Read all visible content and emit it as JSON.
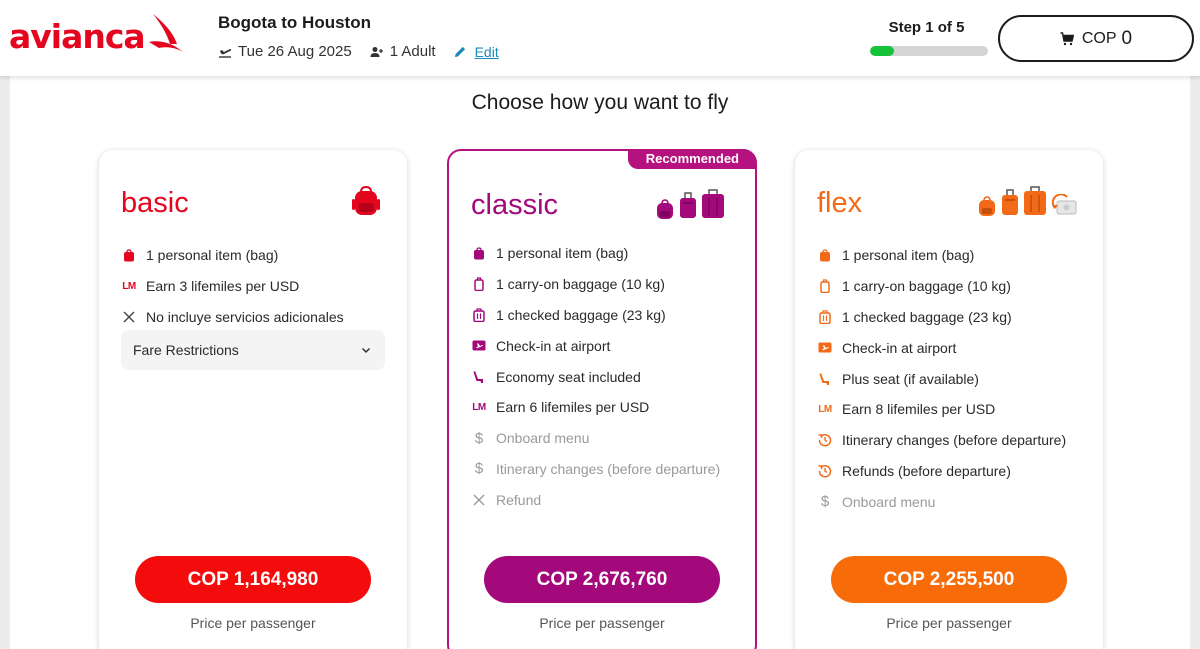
{
  "brand": {
    "name": "avianca",
    "color": "#e4051f"
  },
  "trip": {
    "route": "Bogota to Houston",
    "date": "Tue 26 Aug 2025",
    "passengers": "1 Adult",
    "edit_label": "Edit"
  },
  "progress": {
    "label": "Step 1 of 5",
    "current_step": 1,
    "total_steps": 5,
    "fraction": 0.2,
    "color": "#17c23b"
  },
  "cart": {
    "currency": "COP",
    "amount": "0"
  },
  "page_title": "Choose how you want to fly",
  "fares": [
    {
      "id": "basic",
      "name": "basic",
      "color": "#e4051f",
      "bag_icons": [
        "backpack-icon"
      ],
      "features": [
        {
          "icon": "personal-item-icon",
          "text": "1 personal item (bag)",
          "included": true
        },
        {
          "icon": "lifemiles-icon",
          "text": "Earn 3 lifemiles per USD",
          "included": true
        },
        {
          "icon": "x-icon",
          "text": "No incluye servicios adicionales",
          "included": true
        }
      ],
      "restrictions_label": "Fare Restrictions",
      "price": "COP 1,164,980",
      "price_note": "Price per passenger"
    },
    {
      "id": "classic",
      "name": "classic",
      "color": "#a3097a",
      "badge": "Recommended",
      "bag_icons": [
        "backpack-icon",
        "carry-on-icon",
        "checked-bag-icon"
      ],
      "features": [
        {
          "icon": "personal-item-icon",
          "text": "1 personal item (bag)",
          "included": true
        },
        {
          "icon": "carry-on-icon",
          "text": "1 carry-on baggage (10 kg)",
          "included": true
        },
        {
          "icon": "checked-bag-icon",
          "text": "1 checked baggage (23 kg)",
          "included": true
        },
        {
          "icon": "boarding-pass-icon",
          "text": "Check-in at airport",
          "included": true
        },
        {
          "icon": "seat-icon",
          "text": "Economy seat included",
          "included": true
        },
        {
          "icon": "lifemiles-icon",
          "text": "Earn 6 lifemiles per USD",
          "included": true
        },
        {
          "icon": "dollar-icon",
          "text": "Onboard menu",
          "included": false
        },
        {
          "icon": "dollar-icon",
          "text": "Itinerary changes (before departure)",
          "included": false
        },
        {
          "icon": "x-icon",
          "text": "Refund",
          "included": false
        }
      ],
      "price": "COP 2,676,760",
      "price_note": "Price per passenger"
    },
    {
      "id": "flex",
      "name": "flex",
      "color": "#f26a18",
      "bag_icons": [
        "backpack-icon",
        "carry-on-icon",
        "checked-bag-icon",
        "refund-icon"
      ],
      "features": [
        {
          "icon": "personal-item-icon",
          "text": "1 personal item (bag)",
          "included": true
        },
        {
          "icon": "carry-on-icon",
          "text": "1 carry-on baggage (10 kg)",
          "included": true
        },
        {
          "icon": "checked-bag-icon",
          "text": "1 checked baggage (23 kg)",
          "included": true
        },
        {
          "icon": "boarding-pass-icon",
          "text": "Check-in at airport",
          "included": true
        },
        {
          "icon": "seat-icon",
          "text": "Plus seat (if available)",
          "included": true
        },
        {
          "icon": "lifemiles-icon",
          "text": "Earn 8 lifemiles per USD",
          "included": true
        },
        {
          "icon": "history-icon",
          "text": "Itinerary changes (before departure)",
          "included": true
        },
        {
          "icon": "history-icon",
          "text": "Refunds (before departure)",
          "included": true
        },
        {
          "icon": "dollar-icon",
          "text": "Onboard menu",
          "included": false
        }
      ],
      "price": "COP 2,255,500",
      "price_note": "Price per passenger"
    }
  ]
}
